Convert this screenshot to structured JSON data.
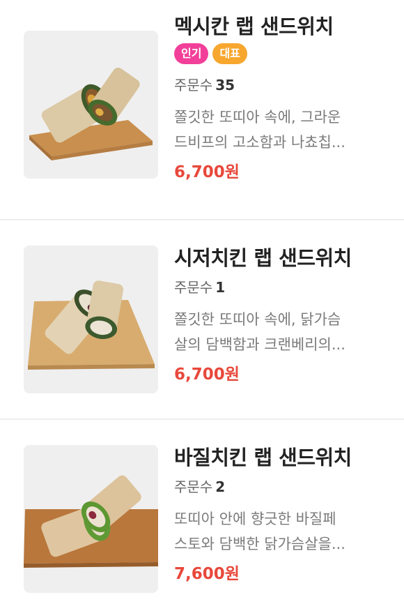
{
  "items": [
    {
      "name": "멕시칸 랩 샌드위치",
      "badges": [
        "인기",
        "대표"
      ],
      "orders_label": "주문수",
      "orders_count": "35",
      "desc_line1": "쫄깃한 또띠아 속에, 그라운",
      "desc_line2": "드비프의 고소함과 나쵸칩...",
      "price": "6,700원"
    },
    {
      "name": "시저치킨 랩 샌드위치",
      "badges": [],
      "orders_label": "주문수",
      "orders_count": "1",
      "desc_line1": "쫄깃한 또띠아 속에, 닭가슴",
      "desc_line2": "살의 담백함과 크랜베리의...",
      "price": "6,700원"
    },
    {
      "name": "바질치킨 랩 샌드위치",
      "badges": [],
      "orders_label": "주문수",
      "orders_count": "2",
      "desc_line1": "또띠아 안에 향긋한 바질페",
      "desc_line2": "스토와 담백한 닭가슴살을...",
      "price": "7,600원"
    }
  ]
}
